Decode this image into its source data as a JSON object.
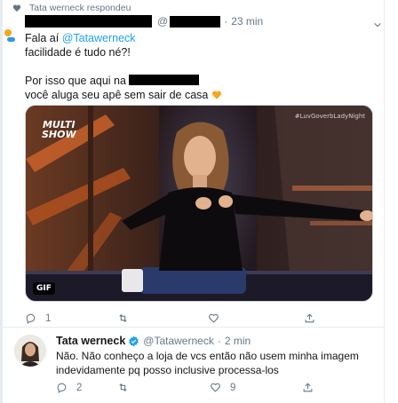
{
  "context": {
    "text": "Tata werneck respondeu",
    "icon": "heart-icon"
  },
  "tweet": {
    "separator_at": "@",
    "separator_dot": "·",
    "time": "23 min",
    "lines": {
      "greeting": "Fala aí ",
      "mention": "@Tatawerneck",
      "line2": "facilidade é tudo né?!",
      "line3_prefix": "Por isso que aqui na",
      "line4": "você aluga seu apê sem sair de casa"
    },
    "media": {
      "badge": "GIF",
      "logo_line1": "MULTI",
      "logo_line2": "SHOW",
      "hashtag": "#LuvGoverbLadyNight"
    },
    "actions": {
      "reply_count": "1",
      "retweet_count": "",
      "like_count": ""
    }
  },
  "reply": {
    "name": "Tata werneck",
    "handle": "@Tatawerneck",
    "separator_dot": "·",
    "time": "2 min",
    "line1": "Não. Não conheço a loja de vcs então não usem minha imagem",
    "line2": "indevidamente pq posso inclusive processa-los",
    "actions": {
      "reply_count": "2",
      "retweet_count": "",
      "like_count": "9"
    }
  },
  "colors": {
    "accent": "#1da1f2",
    "muted": "#657786",
    "text": "#14171a",
    "heart_emoji": "#f5a623"
  }
}
